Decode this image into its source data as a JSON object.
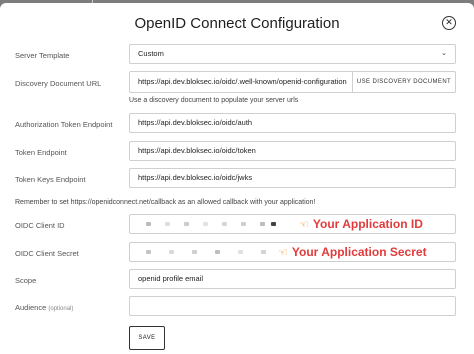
{
  "modal": {
    "title": "OpenID Connect Configuration",
    "close_symbol": "✕"
  },
  "fields": {
    "server_template": {
      "label": "Server Template",
      "value": "Custom",
      "chevron": "⌄"
    },
    "discovery_url": {
      "label": "Discovery Document URL",
      "value": "https://api.dev.bloksec.io/oidc/.well-known/openid-configuration",
      "button": "USE DISCOVERY DOCUMENT",
      "hint": "Use a discovery document to populate your server urls"
    },
    "auth_endpoint": {
      "label": "Authorization Token Endpoint",
      "value": "https://api.dev.bloksec.io/oidc/auth"
    },
    "token_endpoint": {
      "label": "Token Endpoint",
      "value": "https://api.dev.bloksec.io/oidc/token"
    },
    "keys_endpoint": {
      "label": "Token Keys Endpoint",
      "value": "https://api.dev.bloksec.io/oidc/jwks"
    },
    "reminder": "Remember to set https://openidconnect.net/callback as an allowed callback with your application!",
    "client_id": {
      "label": "OIDC Client ID",
      "annotation": "Your Application ID"
    },
    "client_secret": {
      "label": "OIDC Client Secret",
      "annotation": "Your Application Secret"
    },
    "scope": {
      "label": "Scope",
      "value": "openid profile email"
    },
    "audience": {
      "label": "Audience",
      "optional": "(optional)",
      "value": ""
    }
  },
  "save_label": "SAVE",
  "icons": {
    "close": "close-icon",
    "hand": "pointing-hand-icon",
    "chevron": "chevron-down-icon"
  },
  "colors": {
    "annotation": "#e23b3b",
    "backdrop": "#7d7d7d"
  }
}
